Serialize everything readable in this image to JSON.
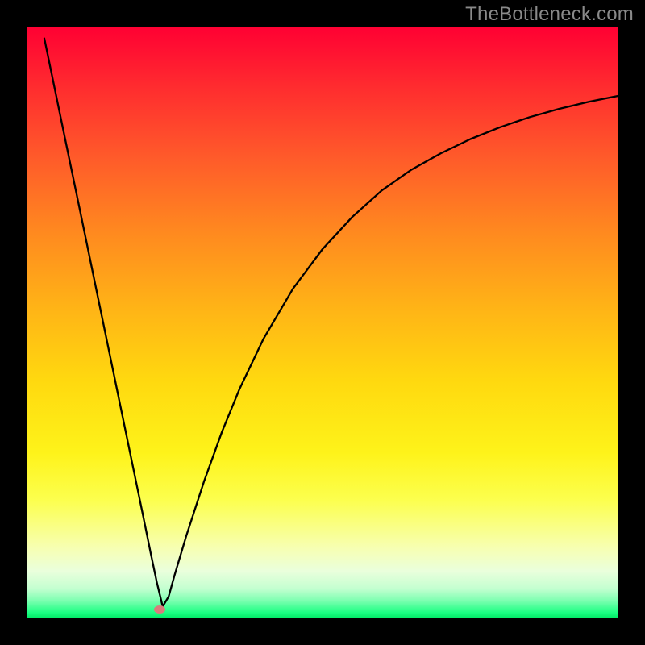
{
  "watermark": "TheBottleneck.com",
  "chart_data": {
    "type": "line",
    "title": "",
    "xlabel": "",
    "ylabel": "",
    "xlim": [
      0,
      100
    ],
    "ylim": [
      0,
      100
    ],
    "grid": false,
    "legend": false,
    "annotations": [],
    "marker": {
      "x": 22.5,
      "y": 1.5,
      "color": "#d97c7c"
    },
    "series": [
      {
        "name": "bottleneck-curve",
        "color": "#000000",
        "x": [
          3,
          6,
          9,
          12,
          15,
          18,
          20,
          21,
          22,
          23,
          24,
          25,
          27,
          30,
          33,
          36,
          40,
          45,
          50,
          55,
          60,
          65,
          70,
          75,
          80,
          85,
          90,
          95,
          100
        ],
        "y": [
          98,
          83.5,
          69,
          54.5,
          40,
          25.5,
          15.8,
          10.9,
          6.1,
          2.0,
          3.7,
          7.3,
          14.0,
          23.2,
          31.5,
          38.8,
          47.2,
          55.7,
          62.4,
          67.8,
          72.3,
          75.8,
          78.6,
          81.0,
          83.0,
          84.7,
          86.1,
          87.3,
          88.3
        ]
      }
    ],
    "background_gradient": {
      "top": "#ff0033",
      "bottom": "#00e865"
    }
  }
}
